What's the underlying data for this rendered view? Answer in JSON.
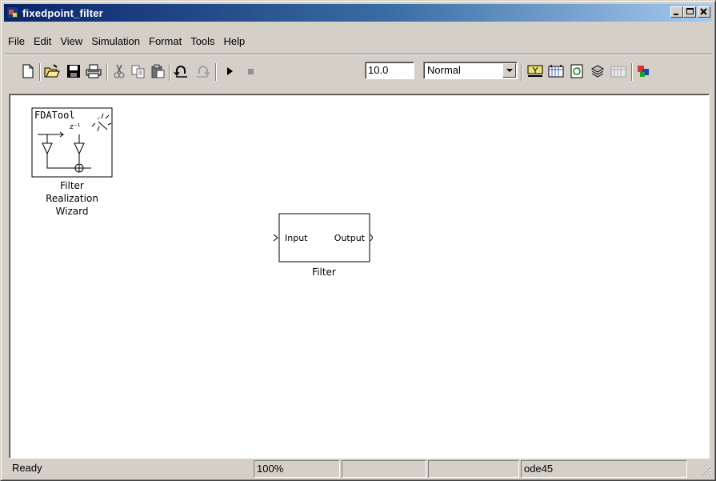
{
  "window": {
    "title": "fixedpoint_filter"
  },
  "menu": [
    "File",
    "Edit",
    "View",
    "Simulation",
    "Format",
    "Tools",
    "Help"
  ],
  "toolbar": {
    "stop_time": "10.0",
    "sim_mode": "Normal",
    "icons": [
      "new-model-icon",
      "open-icon",
      "save-icon",
      "print-icon",
      "cut-icon",
      "copy-icon",
      "paste-icon",
      "undo-icon",
      "redo-icon",
      "start-simulation-icon",
      "stop-simulation-icon",
      "build-icon",
      "update-diagram-icon",
      "refresh-icon",
      "library-browser-icon",
      "model-explorer-icon",
      "debugger-icon"
    ]
  },
  "canvas": {
    "fdatool_block": {
      "text": "FDATool",
      "delay_label": "z⁻¹",
      "label_lines": [
        "Filter",
        "Realization",
        "Wizard"
      ]
    },
    "filter_block": {
      "input_port": "Input",
      "output_port": "Output",
      "label": "Filter"
    }
  },
  "status": {
    "state": "Ready",
    "zoom": "100%",
    "pane3": "",
    "pane4": "",
    "solver": "ode45"
  }
}
